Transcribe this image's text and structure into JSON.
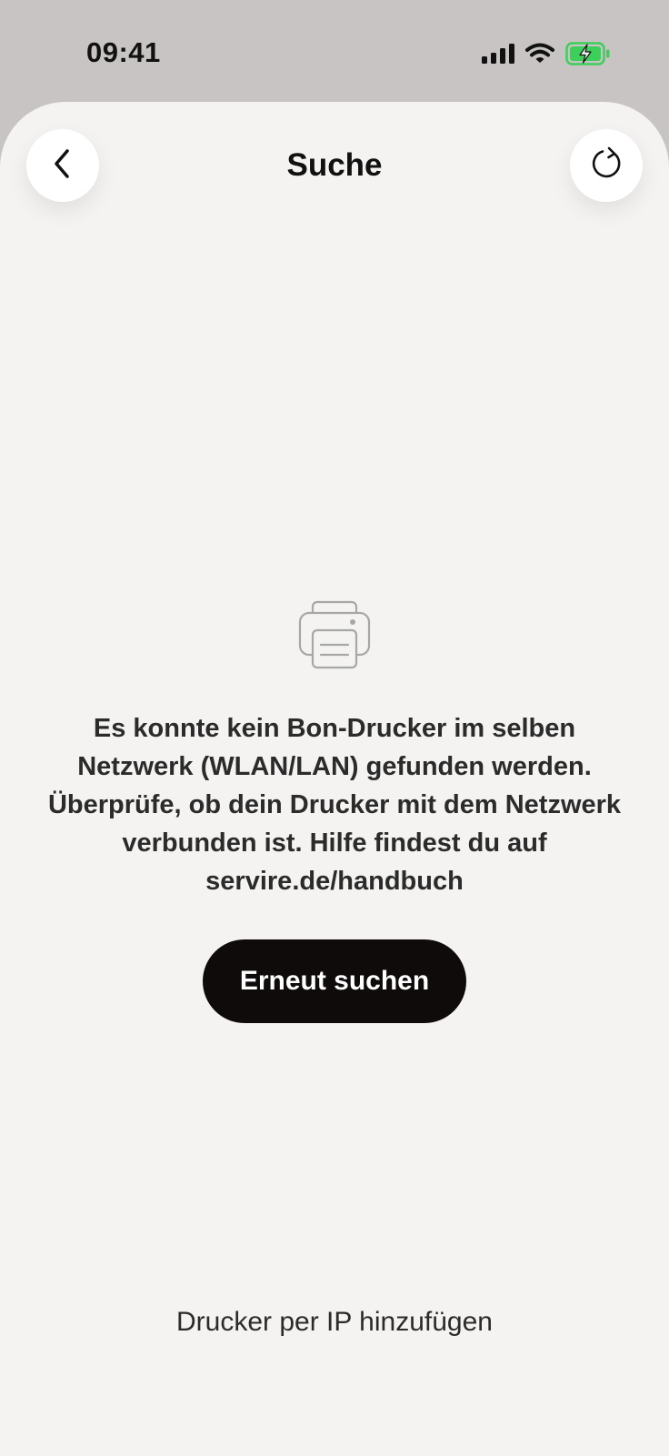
{
  "status_bar": {
    "time": "09:41",
    "signal_icon": "signal-icon",
    "wifi_icon": "wifi-icon",
    "battery_icon": "battery-charging-icon",
    "battery_color": "#3ccf5a"
  },
  "header": {
    "title": "Suche",
    "back_icon": "chevron-left-icon",
    "refresh_icon": "refresh-icon"
  },
  "empty_state": {
    "icon": "printer-icon",
    "message": "Es konnte kein Bon-Drucker im selben Netzwerk (WLAN/LAN) gefunden werden. Überprüfe, ob dein Drucker mit dem Netzwerk verbunden ist. Hilfe findest du auf servire.de/handbuch",
    "retry_label": "Erneut suchen"
  },
  "footer": {
    "add_by_ip_label": "Drucker per IP hinzufügen"
  },
  "colors": {
    "background": "#c8c4c3",
    "sheet": "#f4f3f1",
    "button_dark": "#0f0b0a"
  }
}
